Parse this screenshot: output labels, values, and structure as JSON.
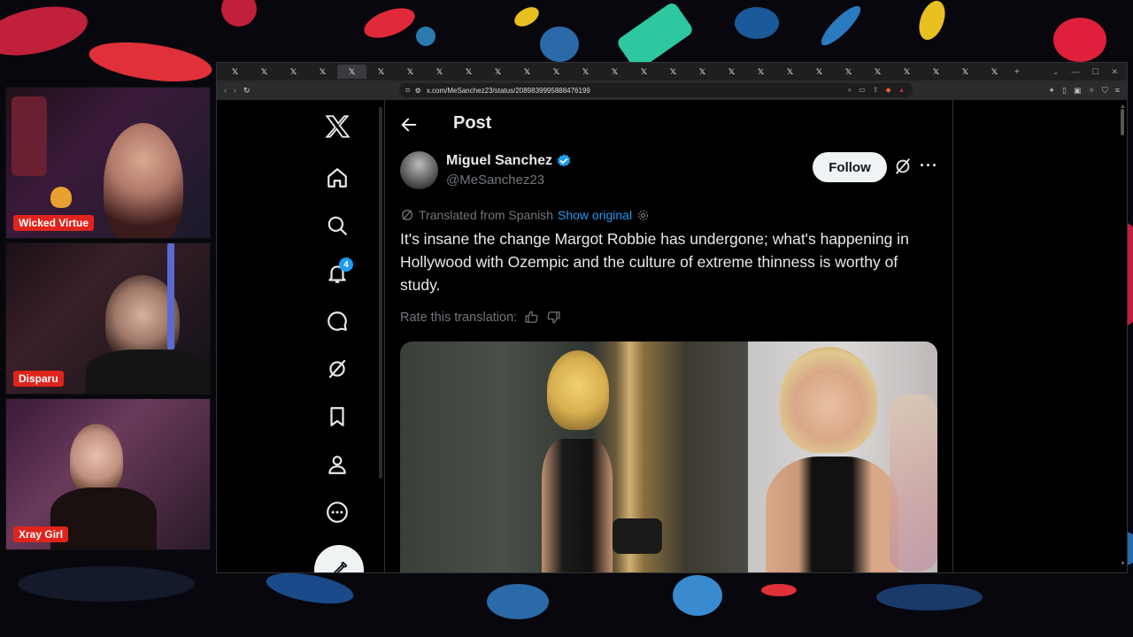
{
  "webcams": [
    {
      "name": "Wicked Virtue"
    },
    {
      "name": "Disparu"
    },
    {
      "name": "Xray Girl"
    }
  ],
  "browser": {
    "tab_count": 27,
    "url": "x.com/MeSanchez23/status/2089839995888476199"
  },
  "x_sidebar": {
    "notifications_badge": "4",
    "icons": [
      "x-logo-icon",
      "home-icon",
      "search-icon",
      "notifications-icon",
      "messages-icon",
      "grok-icon",
      "bookmarks-icon",
      "profile-icon",
      "more-icon",
      "compose-icon"
    ]
  },
  "post": {
    "header_title": "Post",
    "author_name": "Miguel Sanchez",
    "author_handle": "@MeSanchez23",
    "follow_label": "Follow",
    "translated_label": "Translated from Spanish",
    "show_original_label": "Show original",
    "text": "It's insane the change Margot Robbie has undergone; what's happening in Hollywood with Ozempic and the culture of extreme thinness is worthy of study.",
    "rate_label": "Rate this translation:",
    "more_label": "···"
  },
  "colors": {
    "accent": "#1d9bf0",
    "tag_red": "#e0241c",
    "text": "#e7e9ea",
    "muted": "#71767b"
  }
}
